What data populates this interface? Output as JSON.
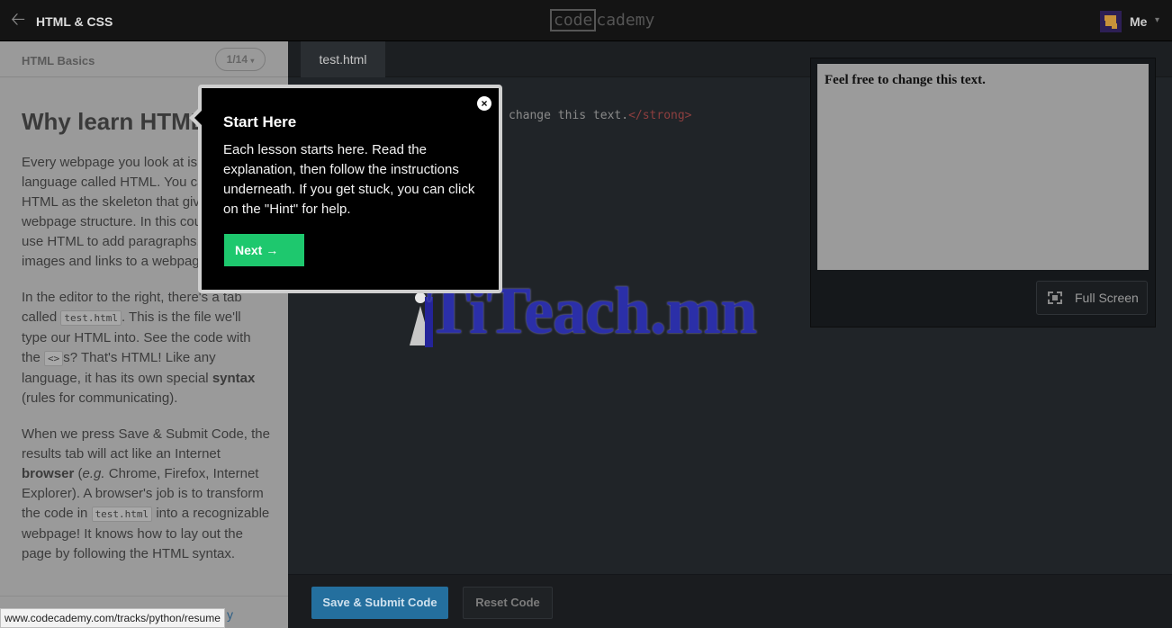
{
  "topbar": {
    "course_title": "HTML & CSS",
    "logo_box": "code",
    "logo_rest": "cademy",
    "user_label": "Me"
  },
  "lesson": {
    "section_name": "HTML Basics",
    "pager": "1/14",
    "heading": "Why learn HTML?",
    "p1": "Every webpage you look at is written in a language called HTML. You can think of HTML as the skeleton that gives every webpage structure. In this course, we'll use HTML to add paragraphs, headings, images and links to a webpage.",
    "p2_a": "In the editor to the right, there's a tab called",
    "p2_code1": "test.html",
    "p2_b": ". This is the file we'll type our HTML into. See the code with the",
    "p2_code2": "<>",
    "p2_c": "s? That's HTML! Like any language, it has its own special",
    "p2_strong": "syntax",
    "p2_d": "(rules for communicating).",
    "p3_a": "When we press Save & Submit Code, the results tab will act like an Internet",
    "p3_strong": "browser",
    "p3_b": "(",
    "p3_em": "e.g.",
    "p3_c": "Chrome, Firefox, Internet Explorer). A browser's job is to transform the code in",
    "p3_code": "test.html",
    "p3_d": "into a recognizable webpage! It knows how to lay out the page by following the HTML syntax.",
    "footer_link": "y"
  },
  "editor": {
    "tab": "test.html",
    "code_text": "change this text.",
    "code_close_tag": "</strong>",
    "submit_label": "Save & Submit Code",
    "reset_label": "Reset Code"
  },
  "preview": {
    "text": "Feel free to change this text.",
    "fullscreen_label": "Full Screen"
  },
  "popup": {
    "title": "Start Here",
    "message": "Each lesson starts here. Read the explanation, then follow the instructions underneath. If you get stuck, you can click on the \"Hint\" for help.",
    "next_label": "Next →",
    "close_glyph": "×"
  },
  "watermark": {
    "text": "TiTeach.mn"
  },
  "status_url": "www.codecademy.com/tracks/python/resume"
}
